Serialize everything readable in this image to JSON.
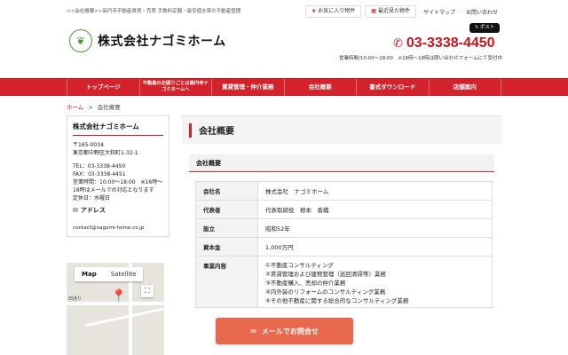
{
  "header": {
    "tagline": "<<会社概要>>高円寺不動産賃貸・売買 手数料定額・最安値水準の不動産管理",
    "favorites_label": "お気に入り物件",
    "recent_label": "最近見た物件",
    "sitemap_label": "サイトマップ",
    "contact_label": "お問い合わせ",
    "company_name": "株式会社ナゴミホーム",
    "post_label": "ポスト",
    "phone": "03-3338-4450",
    "hours": "営業時間/10:00〜18:00　※16時〜18時は問い合わせフォームにて受付中"
  },
  "nav": {
    "items": [
      {
        "label": "トップページ"
      },
      {
        "label": "不動産のお困りごとは高円寺ナゴミホームへ"
      },
      {
        "label": "賃貸管理・仲介業務"
      },
      {
        "label": "会社概要"
      },
      {
        "label": "書式ダウンロード"
      },
      {
        "label": "店舗案内"
      }
    ]
  },
  "breadcrumb": {
    "home": "ホーム",
    "sep": ">",
    "current": "会社概要"
  },
  "sidebar": {
    "title": "株式会社ナゴミホーム",
    "postal": "〒165-0034",
    "address": "東京都中野区大和町1-32-1",
    "tel": "TEL：03-3338-4450",
    "fax": "FAX：03-3338-4451",
    "hours": "営業時間：10:00〜18:00　※16時〜18時はメールでの対応となります",
    "holiday": "定休日：水曜日",
    "address_heading": "アドレス",
    "email": "contact@nagomi-home.co.jp"
  },
  "map": {
    "tab_map": "Map",
    "tab_satellite": "Satellite",
    "label": "田通り"
  },
  "main": {
    "title": "会社概要",
    "section_title": "会社概要",
    "rows": [
      {
        "key": "会社名",
        "value": "株式会社　ナゴミホーム"
      },
      {
        "key": "代表者",
        "value": "代表取締役　根本　香織"
      },
      {
        "key": "設立",
        "value": "昭和52年"
      },
      {
        "key": "資本金",
        "value": "1,000万円"
      }
    ],
    "business_key": "事業内容",
    "business_lines": [
      "①不動産コンサルティング",
      "②賃貸管理および建物管理（巡回清掃等）業務",
      "③不動産購入、売却の仲介業務",
      "④内外装のリフォームのコンサルティング業務",
      "⑤その他不動産に関する総合的なコンサルティング業務"
    ]
  },
  "cta": {
    "label": "メールでお問合せ"
  }
}
